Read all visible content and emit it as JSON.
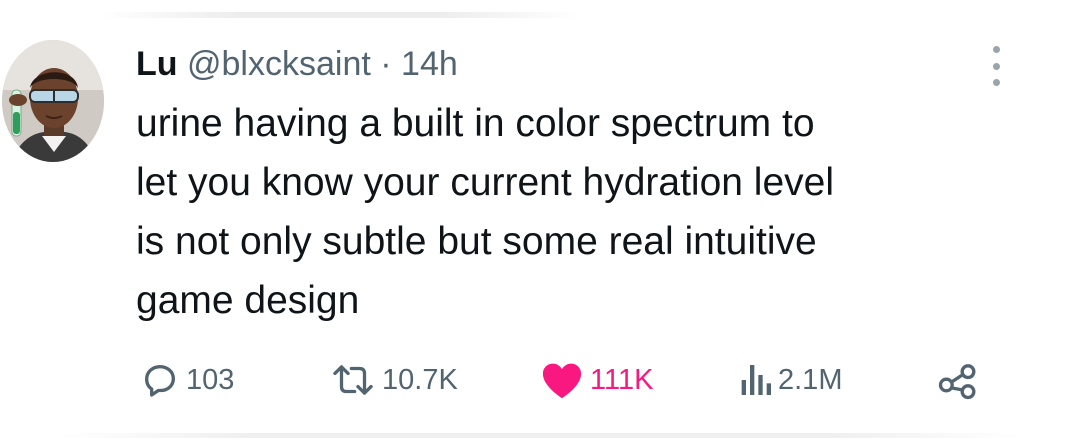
{
  "tweet": {
    "author": {
      "display_name": "Lu",
      "handle": "@blxcksaint",
      "separator": "·",
      "timestamp": "14h"
    },
    "text_lines": [
      "urine having a built in color spectrum to",
      "let you know your current hydration level",
      "is not only subtle but some real intuitive",
      "game design"
    ],
    "actions": {
      "reply": {
        "icon": "reply-icon",
        "count": "103"
      },
      "retweet": {
        "icon": "retweet-icon",
        "count": "10.7K"
      },
      "like": {
        "icon": "heart-icon",
        "count": "111K",
        "active": true,
        "color": "#f91880"
      },
      "views": {
        "icon": "views-icon",
        "count": "2.1M"
      },
      "share": {
        "icon": "share-icon"
      }
    },
    "menu": {
      "icon": "more-icon"
    }
  },
  "colors": {
    "text": "#0f1419",
    "secondary": "#536471",
    "like": "#f91880"
  }
}
